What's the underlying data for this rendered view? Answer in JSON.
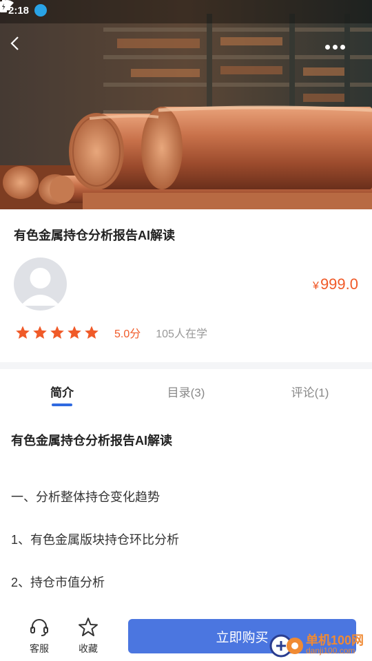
{
  "status_bar": {
    "time": "2:18"
  },
  "course": {
    "title": "有色金属持仓分析报告AI解读",
    "price_symbol": "¥",
    "price": "999.0",
    "score": "5.0分",
    "learners": "105人在学",
    "rating_stars": 5
  },
  "tabs": [
    {
      "label": "简介"
    },
    {
      "label": "目录(3)"
    },
    {
      "label": "评论(1)"
    }
  ],
  "content": {
    "title": "有色金属持仓分析报告AI解读",
    "lines": [
      "一、分析整体持仓变化趋势",
      "1、有色金属版块持仓环比分析",
      "2、持仓市值分析"
    ]
  },
  "bottom_bar": {
    "service_label": "客服",
    "favorite_label": "收藏",
    "buy_label": "立即购买"
  },
  "watermark": {
    "name": "单机100网",
    "url": "danji100.com"
  },
  "colors": {
    "accent": "#f05a28",
    "primary": "#4b76e0",
    "tab_indicator": "#2f6ae0"
  }
}
